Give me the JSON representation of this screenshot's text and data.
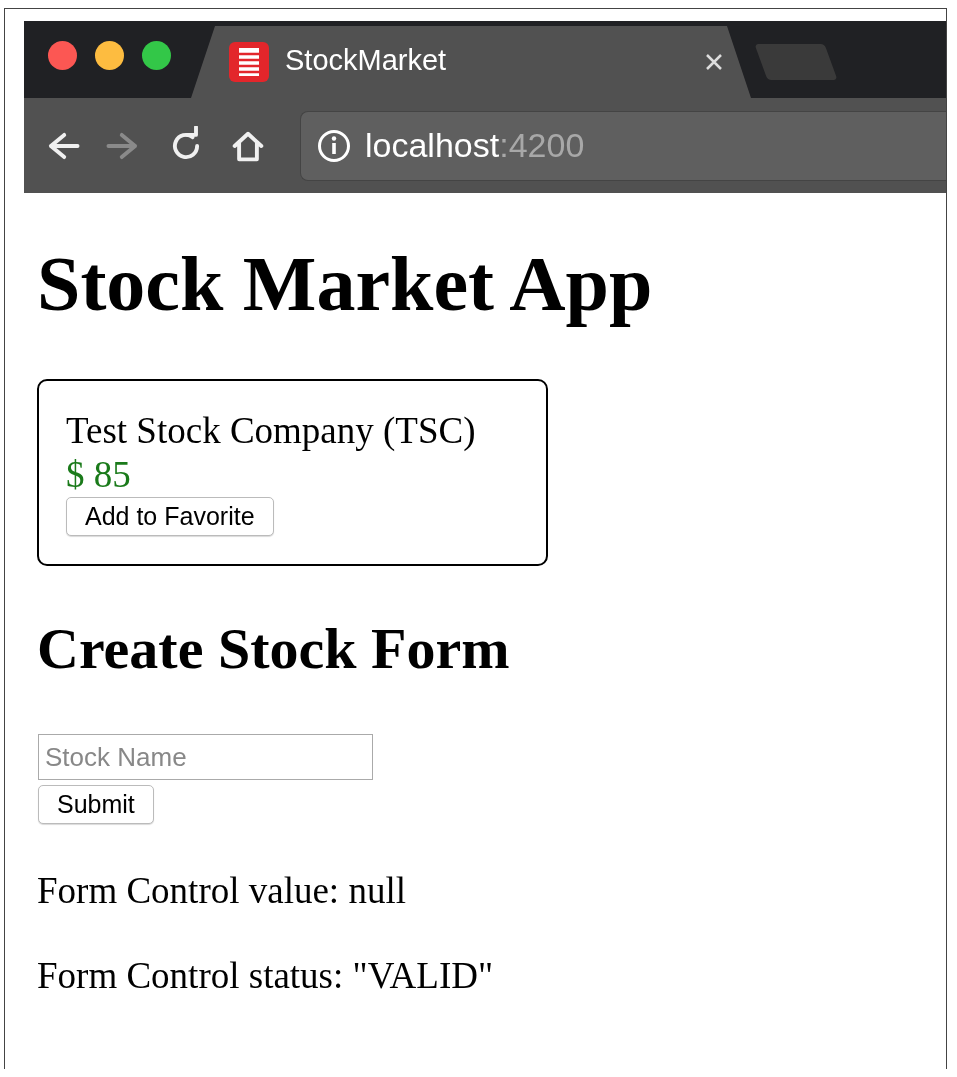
{
  "browser": {
    "tab": {
      "title": "StockMarket",
      "selected": true
    },
    "nav_buttons": [
      {
        "kind": "back",
        "disabled": false
      },
      {
        "kind": "forward",
        "disabled": true
      },
      {
        "kind": "reload",
        "disabled": false
      },
      {
        "kind": "home",
        "disabled": false
      }
    ],
    "address": {
      "host": "localhost",
      "port": ":4200"
    }
  },
  "page": {
    "title": "Stock Market App",
    "stock_card": {
      "name": "Test Stock Company (TSC)",
      "price": "$ 85",
      "button": "Add to Favorite"
    },
    "form": {
      "heading": "Create Stock Form",
      "input": {
        "placeholder": "Stock Name"
      },
      "submit": "Submit"
    },
    "status_lines": [
      "Form Control value: null",
      "Form Control status: \"VALID\""
    ]
  }
}
